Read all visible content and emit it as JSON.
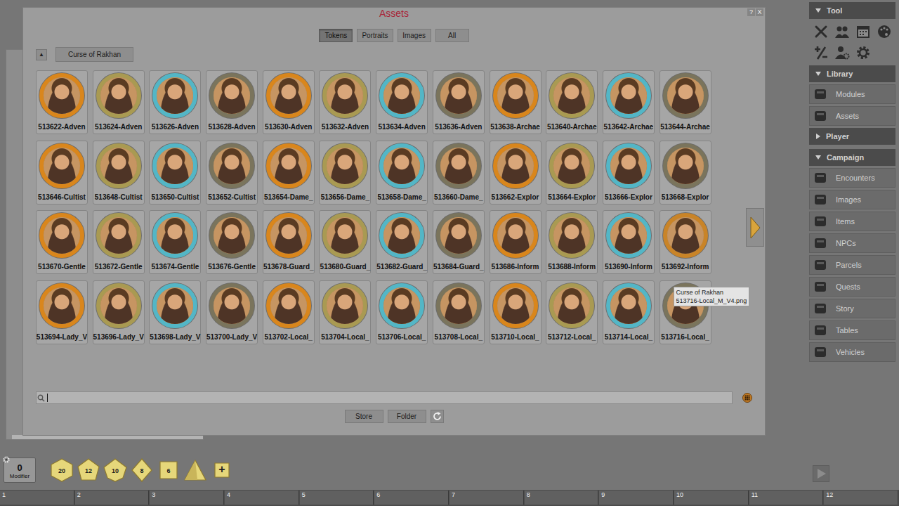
{
  "window": {
    "title": "Assets",
    "controls": [
      "?",
      "X"
    ]
  },
  "tabs": [
    {
      "label": "Tokens",
      "selected": true
    },
    {
      "label": "Portraits",
      "selected": false
    },
    {
      "label": "Images",
      "selected": false
    },
    {
      "label": "All",
      "selected": false
    }
  ],
  "breadcrumb": {
    "up": "▲",
    "path": "Curse of Rakhan"
  },
  "tokens": [
    {
      "label": "513622-Adven",
      "color": "#d9861c",
      "hovered": false
    },
    {
      "label": "513624-Adven",
      "color": "#a99a52",
      "hovered": false
    },
    {
      "label": "513626-Adven",
      "color": "#53b6c6",
      "hovered": false
    },
    {
      "label": "513628-Adven",
      "color": "#7a745c",
      "hovered": false
    },
    {
      "label": "513630-Adven",
      "color": "#d9861c",
      "hovered": false
    },
    {
      "label": "513632-Adven",
      "color": "#a99a52",
      "hovered": false
    },
    {
      "label": "513634-Adven",
      "color": "#53b6c6",
      "hovered": false
    },
    {
      "label": "513636-Adven",
      "color": "#7a745c",
      "hovered": false
    },
    {
      "label": "513638-Archae",
      "color": "#d9861c",
      "hovered": false
    },
    {
      "label": "513640-Archae",
      "color": "#a99a52",
      "hovered": false
    },
    {
      "label": "513642-Archae",
      "color": "#53b6c6",
      "hovered": false
    },
    {
      "label": "513644-Archae",
      "color": "#7a745c",
      "hovered": false
    },
    {
      "label": "513646-Cultist",
      "color": "#d9861c",
      "hovered": false
    },
    {
      "label": "513648-Cultist",
      "color": "#a99a52",
      "hovered": false
    },
    {
      "label": "513650-Cultist",
      "color": "#53b6c6",
      "hovered": false
    },
    {
      "label": "513652-Cultist",
      "color": "#7a745c",
      "hovered": false
    },
    {
      "label": "513654-Dame_",
      "color": "#d9861c",
      "hovered": false
    },
    {
      "label": "513656-Dame_",
      "color": "#a99a52",
      "hovered": false
    },
    {
      "label": "513658-Dame_",
      "color": "#53b6c6",
      "hovered": false
    },
    {
      "label": "513660-Dame_",
      "color": "#7a745c",
      "hovered": false
    },
    {
      "label": "513662-Explor",
      "color": "#d9861c",
      "hovered": false
    },
    {
      "label": "513664-Explor",
      "color": "#a99a52",
      "hovered": false
    },
    {
      "label": "513666-Explor",
      "color": "#53b6c6",
      "hovered": false
    },
    {
      "label": "513668-Explor",
      "color": "#7a745c",
      "hovered": false
    },
    {
      "label": "513670-Gentle",
      "color": "#d9861c",
      "hovered": false
    },
    {
      "label": "513672-Gentle",
      "color": "#a99a52",
      "hovered": false
    },
    {
      "label": "513674-Gentle",
      "color": "#53b6c6",
      "hovered": false
    },
    {
      "label": "513676-Gentle",
      "color": "#7a745c",
      "hovered": false
    },
    {
      "label": "513678-Guard_",
      "color": "#d9861c",
      "hovered": false
    },
    {
      "label": "513680-Guard_",
      "color": "#a99a52",
      "hovered": false
    },
    {
      "label": "513682-Guard_",
      "color": "#53b6c6",
      "hovered": false
    },
    {
      "label": "513684-Guard_",
      "color": "#7a745c",
      "hovered": false
    },
    {
      "label": "513686-Inform",
      "color": "#d9861c",
      "hovered": false
    },
    {
      "label": "513688-Inform",
      "color": "#a99a52",
      "hovered": false
    },
    {
      "label": "513690-Inform",
      "color": "#53b6c6",
      "hovered": false
    },
    {
      "label": "513692-Inform",
      "color": "#c98428",
      "hovered": false
    },
    {
      "label": "513694-Lady_V",
      "color": "#d9861c",
      "hovered": false
    },
    {
      "label": "513696-Lady_V",
      "color": "#a99a52",
      "hovered": false
    },
    {
      "label": "513698-Lady_V",
      "color": "#53b6c6",
      "hovered": false
    },
    {
      "label": "513700-Lady_V",
      "color": "#7a745c",
      "hovered": false
    },
    {
      "label": "513702-Local_",
      "color": "#d9861c",
      "hovered": false
    },
    {
      "label": "513704-Local_",
      "color": "#a99a52",
      "hovered": false
    },
    {
      "label": "513706-Local_",
      "color": "#53b6c6",
      "hovered": false
    },
    {
      "label": "513708-Local_",
      "color": "#7a745c",
      "hovered": false
    },
    {
      "label": "513710-Local_",
      "color": "#d9861c",
      "hovered": false
    },
    {
      "label": "513712-Local_",
      "color": "#a99a52",
      "hovered": false
    },
    {
      "label": "513714-Local_",
      "color": "#53b6c6",
      "hovered": false
    },
    {
      "label": "513716-Local_",
      "color": "#7a745c",
      "hovered": true
    }
  ],
  "tooltip": {
    "lines": [
      "Curse of Rakhan",
      "513716-Local_M_V4.png"
    ]
  },
  "search": {
    "focused": true
  },
  "buttons": [
    "Store",
    "Folder"
  ],
  "sidebar": [
    {
      "title": "Tool",
      "expanded": true,
      "kind": "tools",
      "items": []
    },
    {
      "title": "Library",
      "expanded": true,
      "kind": "list",
      "items": [
        "Modules",
        "Assets"
      ]
    },
    {
      "title": "Player",
      "expanded": false,
      "kind": "list",
      "items": []
    },
    {
      "title": "Campaign",
      "expanded": true,
      "kind": "list",
      "items": [
        "Encounters",
        "Images",
        "Items",
        "NPCs",
        "Parcels",
        "Quests",
        "Story",
        "Tables",
        "Vehicles"
      ]
    }
  ],
  "modifier": {
    "value": "0",
    "label": "Modifier"
  },
  "dice": [
    {
      "kind": "d20",
      "label": "20"
    },
    {
      "kind": "d12",
      "label": "12"
    },
    {
      "kind": "d10",
      "label": "10"
    },
    {
      "kind": "d8",
      "label": "8"
    },
    {
      "kind": "d6",
      "label": "6"
    },
    {
      "kind": "d4"
    },
    {
      "kind": "custom",
      "label": "+"
    }
  ],
  "hotbar": [
    "1",
    "2",
    "3",
    "4",
    "5",
    "6",
    "7",
    "8",
    "9",
    "10",
    "11",
    "12"
  ]
}
